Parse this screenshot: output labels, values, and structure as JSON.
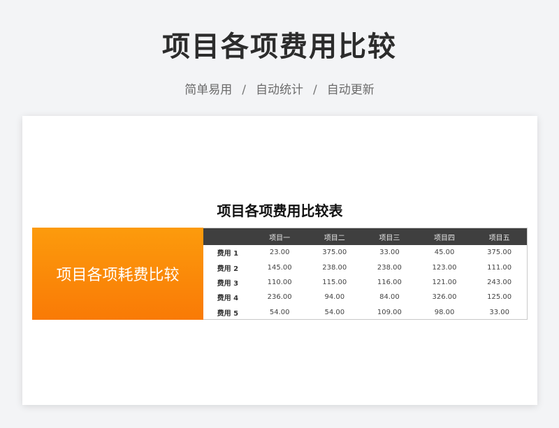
{
  "header": {
    "title": "项目各项费用比较",
    "tags": [
      "简单易用",
      "自动统计",
      "自动更新"
    ],
    "separator": "/"
  },
  "sheet": {
    "table_title": "项目各项费用比较表",
    "banner_text": "项目各项耗费比较",
    "banner_colors": [
      "#fc9b0c",
      "#f97a06"
    ],
    "header_bg": "#3f3f3f",
    "columns": [
      "项目一",
      "项目二",
      "项目三",
      "项目四",
      "项目五"
    ],
    "rows": [
      {
        "label": "费用 1",
        "values": [
          "23.00",
          "375.00",
          "33.00",
          "45.00",
          "375.00"
        ]
      },
      {
        "label": "费用 2",
        "values": [
          "145.00",
          "238.00",
          "238.00",
          "123.00",
          "111.00"
        ]
      },
      {
        "label": "费用 3",
        "values": [
          "110.00",
          "115.00",
          "116.00",
          "121.00",
          "243.00"
        ]
      },
      {
        "label": "费用 4",
        "values": [
          "236.00",
          "94.00",
          "84.00",
          "326.00",
          "125.00"
        ]
      },
      {
        "label": "费用 5",
        "values": [
          "54.00",
          "54.00",
          "109.00",
          "98.00",
          "33.00"
        ]
      }
    ]
  }
}
